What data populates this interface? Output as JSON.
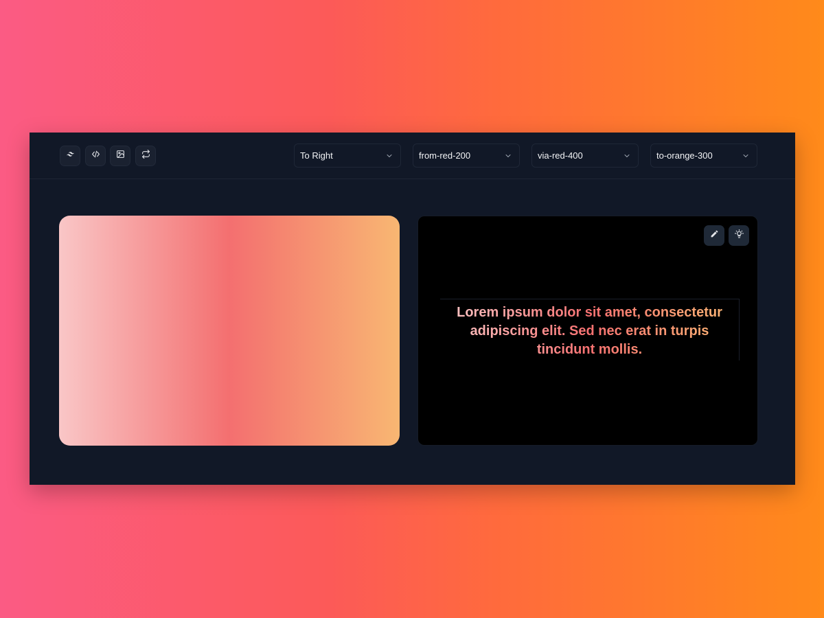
{
  "toolbar": {
    "icons": [
      "tailwind-icon",
      "code-icon",
      "image-icon",
      "refresh-icon"
    ],
    "direction": "To Right",
    "from": "from-red-200",
    "via": "via-red-400",
    "to": "to-orange-300"
  },
  "gradient": {
    "from_color": "#fecaca",
    "via_color": "#f87171",
    "to_color": "#fdba74"
  },
  "preview": {
    "text": "Lorem ipsum dolor sit amet, consectetur adipiscing elit. Sed nec erat in turpis tincidunt mollis.",
    "icons": [
      "pencil-icon",
      "lightbulb-icon"
    ]
  },
  "colors": {
    "window_bg": "#111827",
    "preview_bg": "#000000"
  }
}
